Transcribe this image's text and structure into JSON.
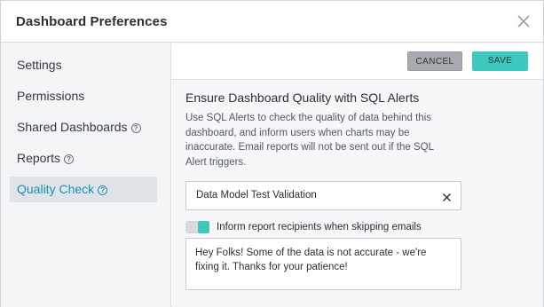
{
  "dialog": {
    "title": "Dashboard Preferences"
  },
  "sidebar": {
    "items": [
      {
        "label": "Settings",
        "help": false
      },
      {
        "label": "Permissions",
        "help": false
      },
      {
        "label": "Shared Dashboards",
        "help": true
      },
      {
        "label": "Reports",
        "help": true
      },
      {
        "label": "Quality Check",
        "help": true,
        "active": true
      }
    ],
    "help_glyph": "?"
  },
  "toolbar": {
    "cancel_label": "CANCEL",
    "save_label": "SAVE"
  },
  "quality": {
    "heading": "Ensure Dashboard Quality with SQL Alerts",
    "description": "Use SQL Alerts to check the quality of data behind this dashboard, and inform users when charts may be inaccurate. Email reports will not be sent out if the SQL Alert triggers.",
    "selected_alert": "Data Model Test Validation",
    "toggle_label": "Inform report recipients when skipping emails",
    "toggle_on": true,
    "message": "Hey Folks! Some of the data is not accurate - we're fixing it. Thanks for your patience!"
  },
  "colors": {
    "accent": "#3fc8bd",
    "active_text": "#1a8fb4"
  },
  "icons": {
    "close": "close-icon",
    "help": "help-circle-icon",
    "clear": "clear-icon"
  }
}
